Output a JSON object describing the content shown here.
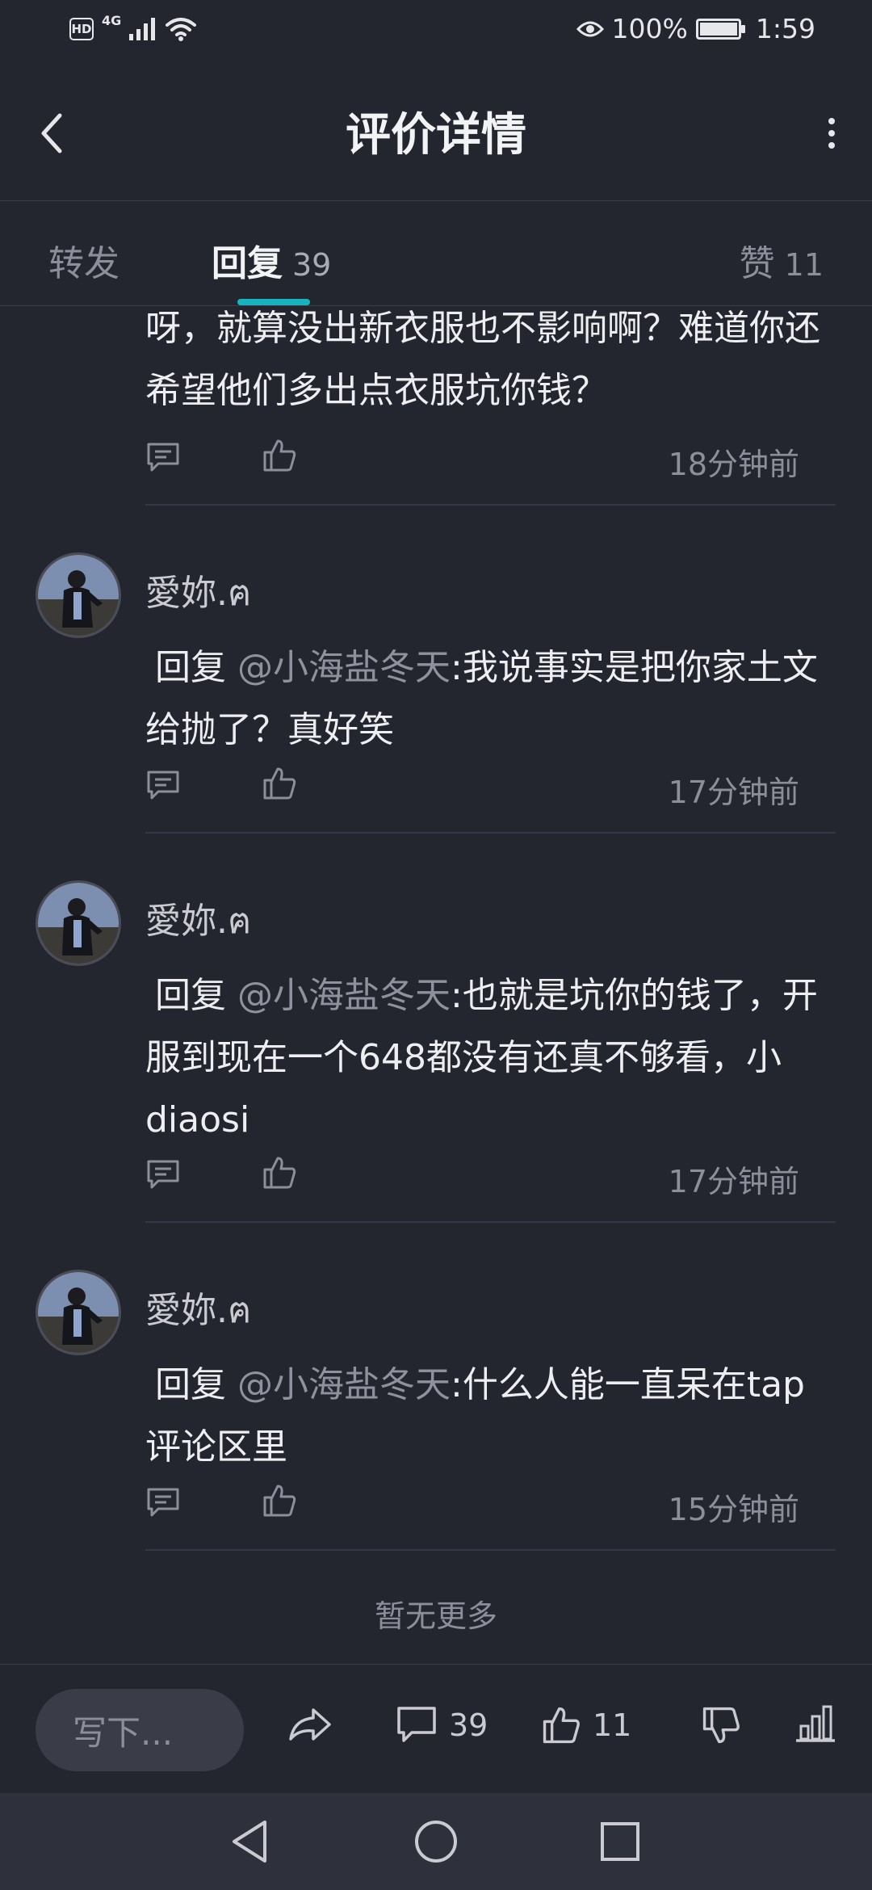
{
  "status_bar": {
    "hd": "HD",
    "network": "4G",
    "battery": "100%",
    "time": "1:59"
  },
  "header": {
    "title": "评价详情",
    "back_icon": "chevron-left-icon",
    "more_icon": "more-vertical-icon"
  },
  "tabs": {
    "forward": {
      "label": "转发"
    },
    "reply": {
      "label": "回复",
      "count": "39"
    },
    "like": {
      "label": "赞",
      "count": "11"
    },
    "active": "reply"
  },
  "replies": [
    {
      "text": "呀，就算没出新衣服也不影响啊？难道你还希望他们多出点衣服坑你钱？",
      "time": "18分钟前"
    },
    {
      "user": "愛妳.ฅ",
      "prefix": "回复",
      "mention": "@小海盐冬天",
      "text": ":我说事实是把你家土文给抛了？真好笑",
      "time": "17分钟前"
    },
    {
      "user": "愛妳.ฅ",
      "prefix": "回复",
      "mention": "@小海盐冬天",
      "text": ":也就是坑你的钱了，开服到现在一个648都没有还真不够看，小diaosi",
      "time": "17分钟前"
    },
    {
      "user": "愛妳.ฅ",
      "prefix": "回复",
      "mention": "@小海盐冬天",
      "text": ":什么人能一直呆在tap评论区里",
      "time": "15分钟前"
    }
  ],
  "no_more": "暂无更多",
  "bottom_bar": {
    "input_placeholder": "写下...",
    "comment_count": "39",
    "like_count": "11",
    "icons": [
      "share-icon",
      "comment-icon",
      "thumb-up-icon",
      "thumb-down-icon",
      "stats-icon"
    ]
  },
  "colors": {
    "background": "#23252f",
    "accent": "#17b4c0",
    "muted": "#8c8f9a"
  }
}
